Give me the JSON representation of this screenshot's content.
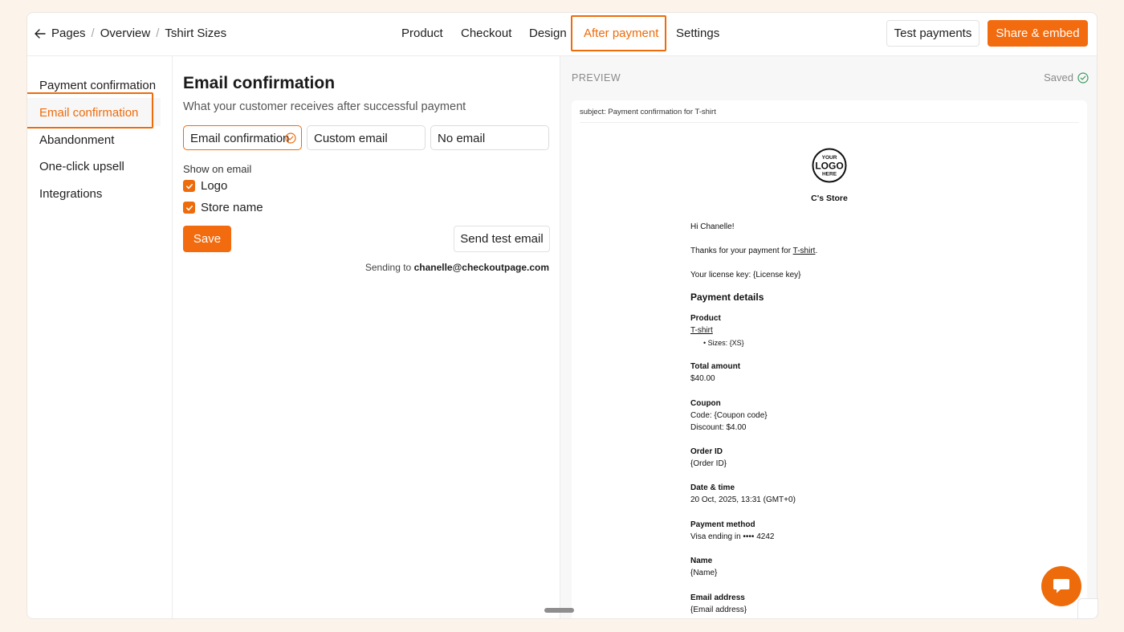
{
  "breadcrumb": {
    "items": [
      "Pages",
      "Overview",
      "Tshirt Sizes"
    ],
    "separator": "/"
  },
  "nav_tabs": {
    "items": [
      "Product",
      "Checkout",
      "Design",
      "After payment",
      "Settings"
    ],
    "active": "After payment"
  },
  "header_buttons": {
    "test_payments": "Test payments",
    "share_embed": "Share & embed"
  },
  "sidebar": {
    "items": [
      "Payment confirmation",
      "Email confirmation",
      "Abandonment",
      "One-click upsell",
      "Integrations"
    ],
    "active": "Email confirmation"
  },
  "editor": {
    "title": "Email confirmation",
    "subtitle": "What your customer receives after successful payment",
    "options": [
      "Email confirmation",
      "Custom email",
      "No email"
    ],
    "selected_option": "Email confirmation",
    "show_on_email_label": "Show on email",
    "checkboxes": [
      {
        "label": "Logo",
        "checked": true
      },
      {
        "label": "Store name",
        "checked": true
      }
    ],
    "save_label": "Save",
    "send_test_label": "Send test email",
    "sending_prefix": "Sending to",
    "sending_email": "chanelle@checkoutpage.com"
  },
  "preview": {
    "label": "PREVIEW",
    "saved_label": "Saved",
    "subject": "subject: Payment confirmation for T-shirt",
    "logo_text": [
      "YOUR",
      "LOGO",
      "HERE"
    ],
    "store_name": "C's Store",
    "greeting": "Hi Chanelle!",
    "thanks_prefix": "Thanks for your payment for ",
    "thanks_link": "T-shirt",
    "thanks_suffix": ".",
    "license_line": "Your license key: {License key}",
    "details_heading": "Payment details",
    "product_label": "Product",
    "product_link": "T-shirt",
    "product_bullet": "Sizes: {XS}",
    "total_label": "Total amount",
    "total_value": "$40.00",
    "coupon_label": "Coupon",
    "coupon_code": "Code: {Coupon code}",
    "coupon_discount": "Discount: $4.00",
    "order_label": "Order ID",
    "order_value": "{Order ID}",
    "date_label": "Date & time",
    "date_value": "20 Oct, 2025, 13:31 (GMT+0)",
    "method_label": "Payment method",
    "method_value": "Visa ending in •••• 4242",
    "name_label": "Name",
    "name_value": "{Name}",
    "email_label": "Email address",
    "email_value": "{Email address}"
  },
  "colors": {
    "accent": "#ee6b0b",
    "background": "#fcf3ea"
  }
}
